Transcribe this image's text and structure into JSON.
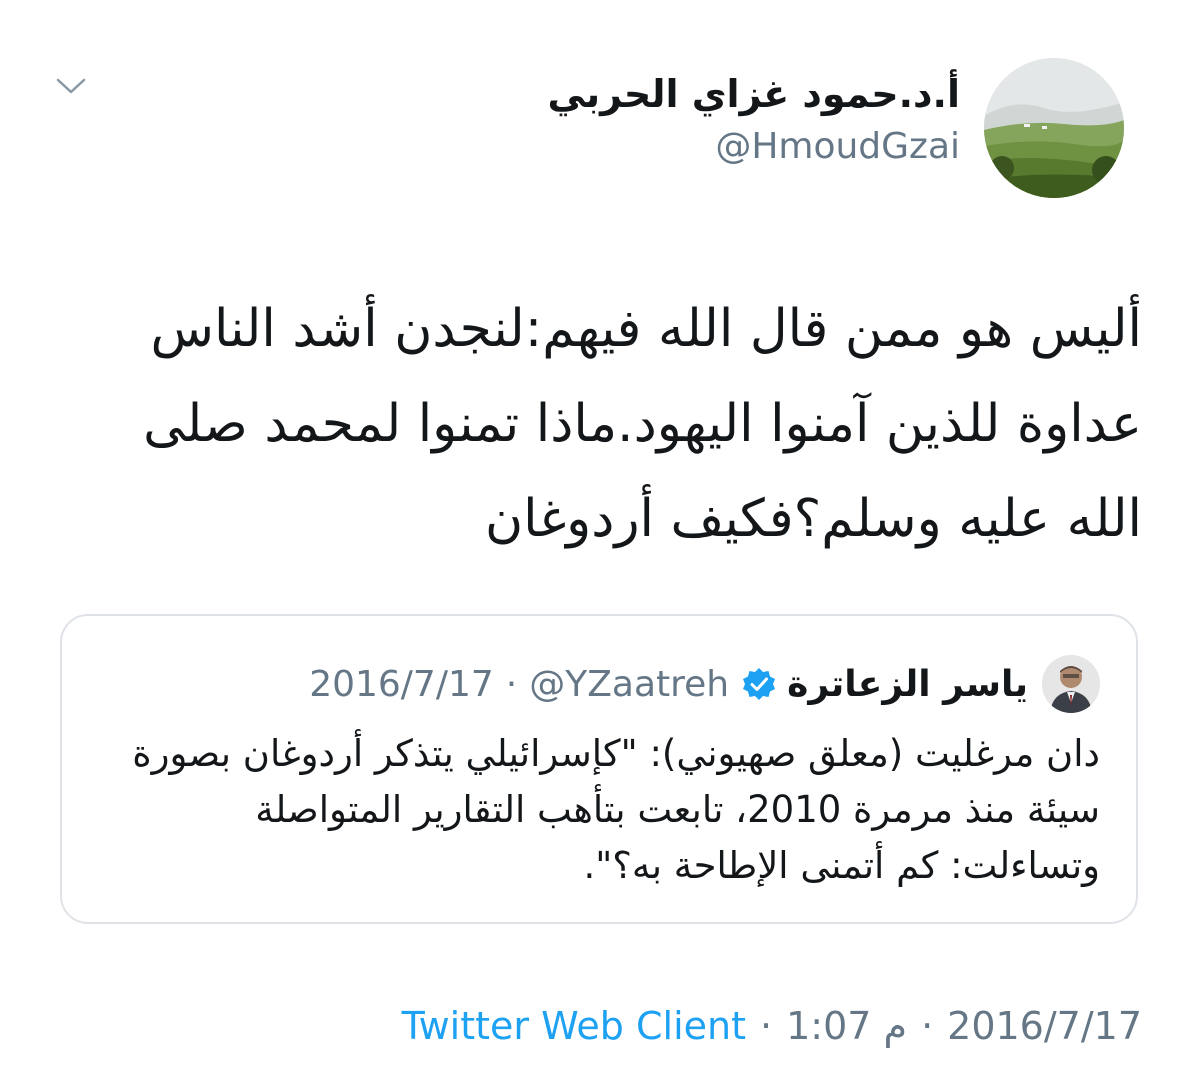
{
  "tweet": {
    "author": {
      "name": "أ.د.حمود غزاي الحربي",
      "handle": "@HmoudGzai",
      "avatar_icon": "landscape-avatar"
    },
    "menu_icon": "chevron-down-icon",
    "text": "أليس هو ممن قال الله فيهم:لنجدن أشد الناس عداوة للذين آمنوا اليهود.ماذا تمنوا لمحمد صلى الله عليه وسلم؟فكيف أردوغان",
    "quoted": {
      "name": "ياسر الزعاترة",
      "verified": true,
      "handle": "@YZaatreh",
      "separator": "·",
      "date": "2016/7/17",
      "text": "دان مرغليت (معلق صهيوني): \"كإسرائيلي يتذكر أردوغان بصورة سيئة منذ مرمرة 2010، تابعت بتأهب التقارير المتواصلة وتساءلت: كم أتمنى الإطاحة به؟\"."
    },
    "meta": {
      "date": "2016/7/17",
      "separator": "·",
      "time": "1:07 م",
      "client": "Twitter Web Client"
    }
  },
  "colors": {
    "text": "#14171a",
    "secondary": "#657786",
    "link": "#1da1f2",
    "border": "#dfe3e8",
    "verified": "#1da1f2"
  }
}
